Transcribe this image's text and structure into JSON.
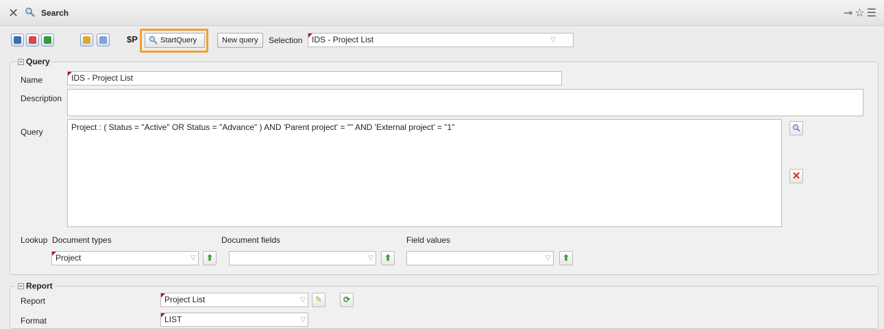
{
  "window": {
    "title": "Search"
  },
  "toolbar": {
    "sp_label": "$P",
    "start_query_label": "StartQuery",
    "new_query_label": "New query",
    "selection_label": "Selection",
    "selection_value": "IDS - Project List"
  },
  "query_section": {
    "legend": "Query",
    "name_label": "Name",
    "name_value": "IDS - Project List",
    "description_label": "Description",
    "description_value": "",
    "query_label": "Query",
    "query_value": "Project : ( Status = \"Active\" OR Status = \"Advance\" ) AND 'Parent project' = \"\" AND 'External project' = \"1\"",
    "lookup_label": "Lookup",
    "doc_types_label": "Document types",
    "doc_types_value": "Project",
    "doc_fields_label": "Document fields",
    "doc_fields_value": "",
    "field_values_label": "Field values",
    "field_values_value": ""
  },
  "report_section": {
    "legend": "Report",
    "report_label": "Report",
    "report_value": "Project List",
    "format_label": "Format",
    "format_value": "LIST"
  },
  "colors": {
    "highlight": "#f0a030",
    "required_marker": "#a02020"
  }
}
